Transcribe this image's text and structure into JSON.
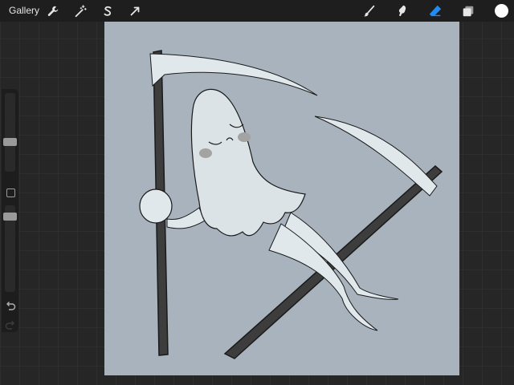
{
  "topbar": {
    "gallery_label": "Gallery",
    "left_tools": [
      {
        "name": "actions",
        "icon": "wrench-icon"
      },
      {
        "name": "adjustments",
        "icon": "magic-wand-icon"
      },
      {
        "name": "selection",
        "icon": "selection-s-icon"
      },
      {
        "name": "transform",
        "icon": "arrow-cursor-icon"
      }
    ],
    "right_tools": [
      {
        "name": "brush",
        "icon": "brush-icon",
        "active": false
      },
      {
        "name": "smudge",
        "icon": "smudge-icon",
        "active": false
      },
      {
        "name": "eraser",
        "icon": "eraser-icon",
        "active": true
      },
      {
        "name": "layers",
        "icon": "layers-icon",
        "active": false
      }
    ],
    "current_color": "#ffffff"
  },
  "sidebar": {
    "brush_size_level": 0.6,
    "opacity_level": 0.88,
    "undo_icon": "undo-icon",
    "redo_icon": "redo-icon"
  },
  "canvas": {
    "background": "#a8b3bd",
    "artwork": "ghost-with-scythes"
  },
  "colors": {
    "accent": "#1f8cf5",
    "toolbar_bg": "#1e1e1e",
    "icon": "#e6e6e6"
  }
}
